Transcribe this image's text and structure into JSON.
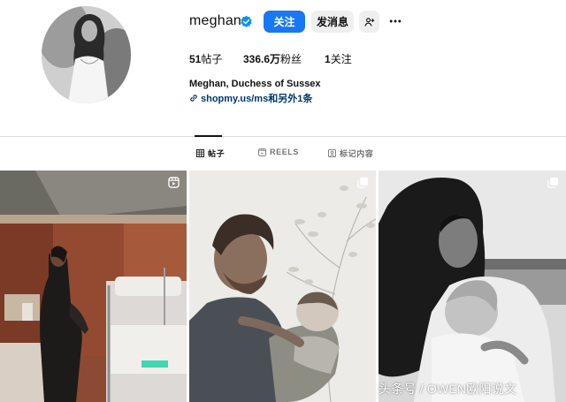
{
  "profile": {
    "username": "meghan",
    "verified": true,
    "follow_label": "关注",
    "message_label": "发消息",
    "full_name": "Meghan, Duchess of Sussex",
    "link_text": "shopmy.us/ms和另外1条"
  },
  "stats": {
    "posts_count": "51",
    "posts_label": "帖子",
    "followers_count": "336.6万",
    "followers_label": "粉丝",
    "following_count": "1",
    "following_label": "关注"
  },
  "tabs": [
    {
      "label": "帖子",
      "active": true
    },
    {
      "label": "REELS",
      "active": false
    },
    {
      "label": "标记内容",
      "active": false
    }
  ],
  "posts": [
    {
      "badge": "reel-icon"
    },
    {
      "badge": "carousel-icon"
    },
    {
      "badge": "carousel-icon"
    }
  ],
  "watermark": "头条号 / OWEN欧阳说文",
  "colors": {
    "accent": "#1877f2",
    "link": "#00376b",
    "secondary_button": "#efefef",
    "muted_text": "#737373"
  }
}
